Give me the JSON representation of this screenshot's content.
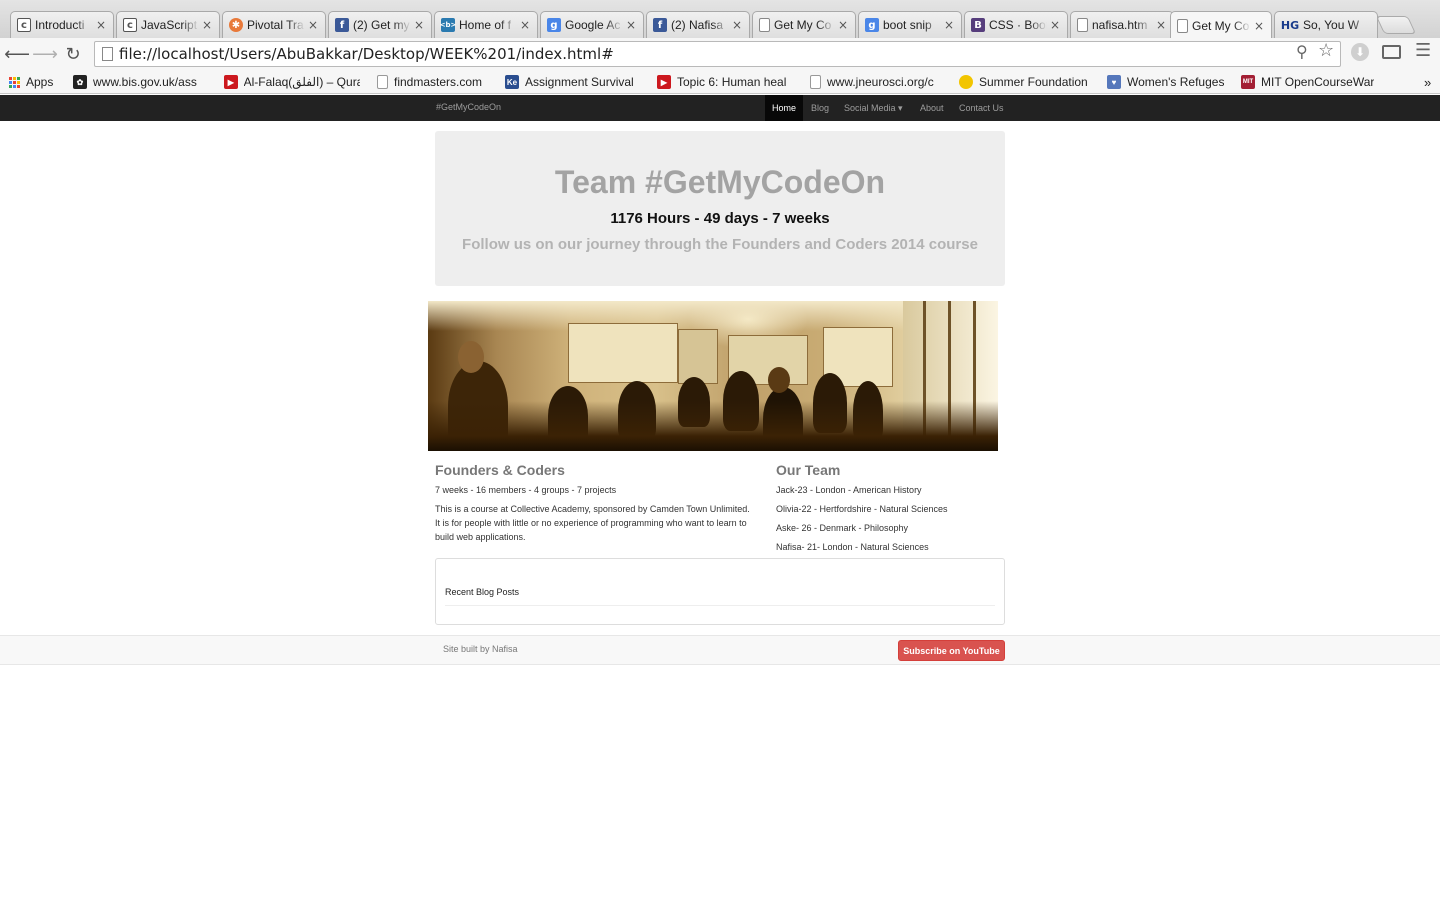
{
  "browser": {
    "tabs": [
      {
        "title": "Introducti",
        "icon": "document-code-icon",
        "color": "#4a4a4a"
      },
      {
        "title": "JavaScript",
        "icon": "document-code-icon",
        "color": "#4a4a4a"
      },
      {
        "title": "Pivotal Tra",
        "icon": "pivotal-icon",
        "color": "#e8793a"
      },
      {
        "title": "(2) Get my",
        "icon": "facebook-icon",
        "color": "#3b5998"
      },
      {
        "title": "Home of f",
        "icon": "code-brackets-icon",
        "color": "#2a7ab0"
      },
      {
        "title": "Google Ac",
        "icon": "google-icon",
        "color": "#4a86e8"
      },
      {
        "title": "(2) Nafisa",
        "icon": "facebook-icon",
        "color": "#3b5998"
      },
      {
        "title": "Get My Co",
        "icon": "page-icon",
        "color": "#ffffff"
      },
      {
        "title": "boot snip",
        "icon": "google-icon",
        "color": "#4a86e8"
      },
      {
        "title": "CSS · Boot",
        "icon": "bootstrap-icon",
        "color": "#563d7c"
      },
      {
        "title": "nafisa.htm",
        "icon": "page-icon",
        "color": "#ffffff"
      },
      {
        "title": "Get My Co",
        "icon": "page-icon",
        "color": "#ffffff"
      },
      {
        "title": "So, You W",
        "icon": "hg-icon",
        "color": "#ffffff"
      }
    ],
    "active_tab_index": 11,
    "url": "file://localhost/Users/AbuBakkar/Desktop/WEEK%201/index.html#",
    "bookmarks": [
      {
        "label": "Apps",
        "icon": "apps-grid-icon"
      },
      {
        "label": "www.bis.gov.uk/ass",
        "icon": "bis-icon",
        "color": "#222222"
      },
      {
        "label": "Al-Falaq(الفلق) – Qura",
        "icon": "youtube-icon",
        "color": "#cc181e"
      },
      {
        "label": "findmasters.com",
        "icon": "page-icon",
        "color": "#ffffff"
      },
      {
        "label": "Assignment Survival",
        "icon": "ke-icon",
        "color": "#2a4d8f"
      },
      {
        "label": "Topic 6: Human heal",
        "icon": "youtube-icon",
        "color": "#cc181e"
      },
      {
        "label": "www.jneurosci.org/c",
        "icon": "page-icon",
        "color": "#ffffff"
      },
      {
        "label": "Summer Foundation",
        "icon": "sun-icon",
        "color": "#f2c500"
      },
      {
        "label": "Women's Refuges",
        "icon": "refuge-icon",
        "color": "#5577bb"
      },
      {
        "label": "MIT OpenCourseWar",
        "icon": "mit-icon",
        "color": "#a31f34"
      }
    ],
    "more_bookmarks": "»"
  },
  "site": {
    "brand": "#GetMyCodeOn",
    "nav": [
      "Home",
      "Blog",
      "Social Media ▾",
      "About",
      "Contact Us"
    ],
    "jumbotron": {
      "title": "Team #GetMyCodeOn",
      "stats": "1176 Hours - 49 days - 7 weeks",
      "tagline": "Follow us on our journey through the Founders and Coders 2014 course"
    },
    "founders": {
      "heading": "Founders & Coders",
      "summary": "7 weeks - 16 members - 4 groups - 7 projects",
      "description": "This is a course at Collective Academy, sponsored by Camden Town Unlimited. It is for people with little or no experience of programming who want to learn to build web applications."
    },
    "team": {
      "heading": "Our Team",
      "members": [
        "Jack-23 - London - American History",
        "Olivia-22 - Hertfordshire - Natural Sciences",
        "Aske- 26 - Denmark - Philosophy",
        "Nafisa- 21- London - Natural Sciences"
      ]
    },
    "blog_panel": {
      "heading": "Recent Blog Posts"
    },
    "footer": {
      "credit": "Site built by Nafisa",
      "youtube_button": "Subscribe on YouTube",
      "youtube_color": "#d9534f"
    }
  }
}
